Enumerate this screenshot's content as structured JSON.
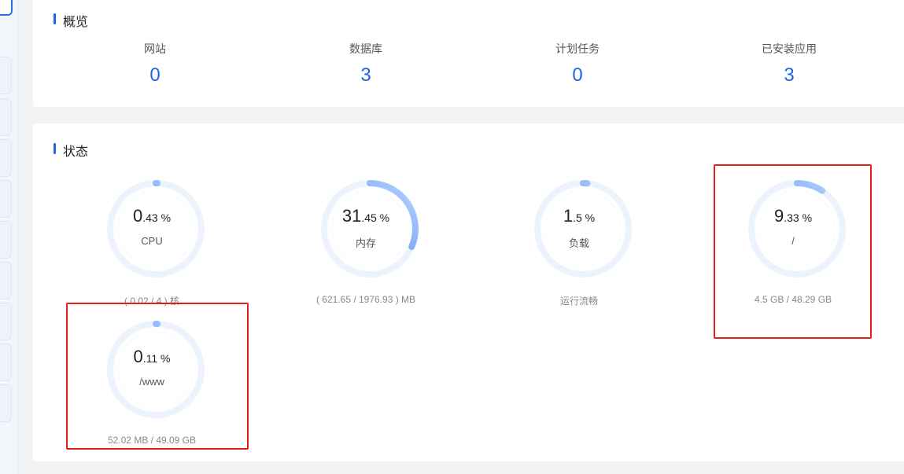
{
  "overview": {
    "title": "概览",
    "items": [
      {
        "label": "网站",
        "value": "0"
      },
      {
        "label": "数据库",
        "value": "3"
      },
      {
        "label": "计划任务",
        "value": "0"
      },
      {
        "label": "已安装应用",
        "value": "3"
      }
    ]
  },
  "status": {
    "title": "状态",
    "gauges": [
      {
        "int": "0",
        "dec": ".43",
        "unit": " %",
        "name": "CPU",
        "sub": "( 0.02 / 4 ) 核",
        "percent": 0.43
      },
      {
        "int": "31",
        "dec": ".45",
        "unit": " %",
        "name": "内存",
        "sub": "( 621.65 / 1976.93 ) MB",
        "percent": 31.45
      },
      {
        "int": "1",
        "dec": ".5",
        "unit": " %",
        "name": "负载",
        "sub": "运行流畅",
        "percent": 1.5
      },
      {
        "int": "9",
        "dec": ".33",
        "unit": " %",
        "name": "/",
        "sub": "4.5 GB / 48.29 GB",
        "percent": 9.33
      },
      {
        "int": "0",
        "dec": ".11",
        "unit": " %",
        "name": "/www",
        "sub": "52.02 MB / 49.09 GB",
        "percent": 0.11
      }
    ]
  },
  "colors": {
    "accent": "#1d64e8",
    "gauge_track": "#edf3fc",
    "gauge_start": "#3b6ff0",
    "gauge_end": "#b8d5ff",
    "highlight_box": "#e02020"
  }
}
